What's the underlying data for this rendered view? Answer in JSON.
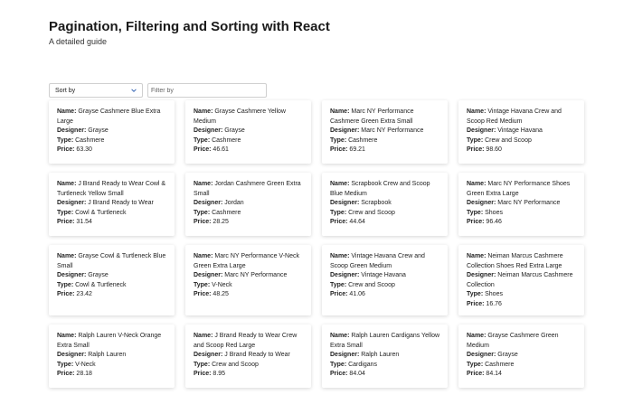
{
  "header": {
    "title": "Pagination, Filtering and Sorting with React",
    "subtitle": "A detailed guide"
  },
  "controls": {
    "sort_label": "Sort by",
    "filter_placeholder": "Filter by"
  },
  "labels": {
    "name": "Name:",
    "designer": "Designer:",
    "type": "Type:",
    "price": "Price:"
  },
  "products": [
    {
      "name": "Grayse Cashmere Blue Extra Large",
      "designer": "Grayse",
      "type": "Cashmere",
      "price": "63.30"
    },
    {
      "name": "Grayse Cashmere Yellow Medium",
      "designer": "Grayse",
      "type": "Cashmere",
      "price": "46.61"
    },
    {
      "name": "Marc NY Performance Cashmere Green Extra Small",
      "designer": "Marc NY Performance",
      "type": "Cashmere",
      "price": "69.21"
    },
    {
      "name": "Vintage Havana Crew and Scoop Red Medium",
      "designer": "Vintage Havana",
      "type": "Crew and Scoop",
      "price": "98.60"
    },
    {
      "name": "J Brand Ready to Wear Cowl & Turtleneck Yellow Small",
      "designer": "J Brand Ready to Wear",
      "type": "Cowl & Turtleneck",
      "price": "31.54"
    },
    {
      "name": "Jordan Cashmere Green Extra Small",
      "designer": "Jordan",
      "type": "Cashmere",
      "price": "28.25"
    },
    {
      "name": "Scrapbook Crew and Scoop Blue Medium",
      "designer": "Scrapbook",
      "type": "Crew and Scoop",
      "price": "44.64"
    },
    {
      "name": "Marc NY Performance Shoes Green Extra Large",
      "designer": "Marc NY Performance",
      "type": "Shoes",
      "price": "96.46"
    },
    {
      "name": "Grayse Cowl & Turtleneck Blue Small",
      "designer": "Grayse",
      "type": "Cowl & Turtleneck",
      "price": "23.42"
    },
    {
      "name": "Marc NY Performance V-Neck Green Extra Large",
      "designer": "Marc NY Performance",
      "type": "V-Neck",
      "price": "48.25"
    },
    {
      "name": "Vintage Havana Crew and Scoop Green Medium",
      "designer": "Vintage Havana",
      "type": "Crew and Scoop",
      "price": "41.06"
    },
    {
      "name": "Neiman Marcus Cashmere Collection Shoes Red Extra Large",
      "designer": "Neiman Marcus Cashmere Collection",
      "type": "Shoes",
      "price": "16.76"
    },
    {
      "name": "Ralph Lauren V-Neck Orange Extra Small",
      "designer": "Ralph Lauren",
      "type": "V-Neck",
      "price": "28.18"
    },
    {
      "name": "J Brand Ready to Wear Crew and Scoop Red Large",
      "designer": "J Brand Ready to Wear",
      "type": "Crew and Scoop",
      "price": "8.95"
    },
    {
      "name": "Ralph Lauren Cardigans Yellow Extra Small",
      "designer": "Ralph Lauren",
      "type": "Cardigans",
      "price": "84.04"
    },
    {
      "name": "Grayse Cashmere Green Medium",
      "designer": "Grayse",
      "type": "Cashmere",
      "price": "84.14"
    }
  ]
}
